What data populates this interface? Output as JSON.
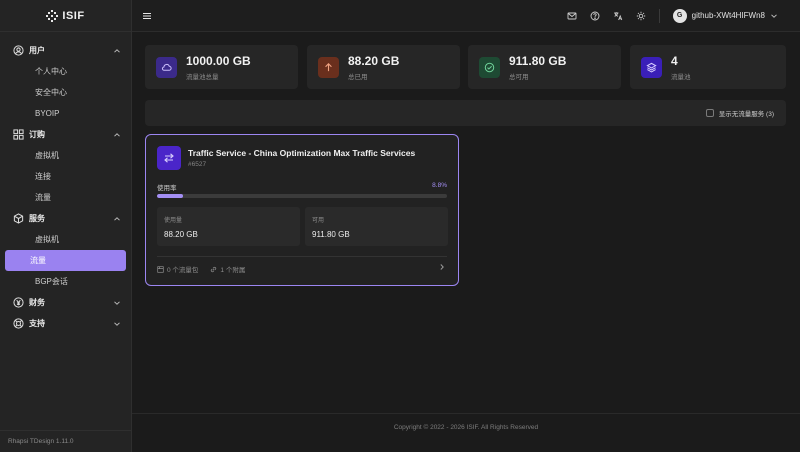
{
  "brand": {
    "name": "ISIF"
  },
  "sidebar": {
    "groups": [
      {
        "label": "用户",
        "icon": "user-circle-icon",
        "expanded": true,
        "items": [
          {
            "label": "个人中心",
            "active": false
          },
          {
            "label": "安全中心",
            "active": false
          },
          {
            "label": "BYOIP",
            "active": false
          }
        ]
      },
      {
        "label": "订购",
        "icon": "grid-icon",
        "expanded": true,
        "items": [
          {
            "label": "虚拟机",
            "active": false
          },
          {
            "label": "连接",
            "active": false
          },
          {
            "label": "流量",
            "active": false
          }
        ]
      },
      {
        "label": "服务",
        "icon": "cube-icon",
        "expanded": true,
        "items": [
          {
            "label": "虚拟机",
            "active": false
          },
          {
            "label": "流量",
            "active": true
          },
          {
            "label": "BGP会话",
            "active": false
          }
        ]
      },
      {
        "label": "财务",
        "icon": "yen-icon",
        "expanded": false,
        "items": []
      },
      {
        "label": "支持",
        "icon": "lifebuoy-icon",
        "expanded": false,
        "items": []
      }
    ],
    "footer": "Rhapsi TDesign 1.11.0"
  },
  "topbar": {
    "user": {
      "avatar_letter": "G",
      "name": "github-XWt4HIFWn8"
    }
  },
  "stats": [
    {
      "value": "1000.00 GB",
      "label": "流量池总量",
      "icon": "cloud-icon",
      "bg": "#3b2a8a",
      "fg": "#c9bdfb"
    },
    {
      "value": "88.20 GB",
      "label": "总已用",
      "icon": "arrow-up-icon",
      "bg": "#6a2f1d",
      "fg": "#f0a281"
    },
    {
      "value": "911.80 GB",
      "label": "总可用",
      "icon": "check-circle-icon",
      "bg": "#1e4a33",
      "fg": "#6fd39a"
    },
    {
      "value": "4",
      "label": "流量池",
      "icon": "layers-icon",
      "bg": "#3a1fb8",
      "fg": "#d6ccff"
    }
  ],
  "filter": {
    "label": "显示无流量服务 (3)",
    "checked": false
  },
  "service_card": {
    "title": "Traffic Service - China Optimization Max Traffic Services",
    "id": "#6527",
    "usage_label": "使用率",
    "usage_percent_text": "8.8%",
    "usage_fraction": 0.088,
    "used": {
      "label": "使用量",
      "value": "88.20 GB"
    },
    "available": {
      "label": "可用",
      "value": "911.80 GB"
    },
    "footer": {
      "pools": "0 个流量包",
      "attachments": "1 个附属"
    }
  },
  "copyright": "Copyright © 2022 - 2026 ISIF. All Rights Reserved"
}
